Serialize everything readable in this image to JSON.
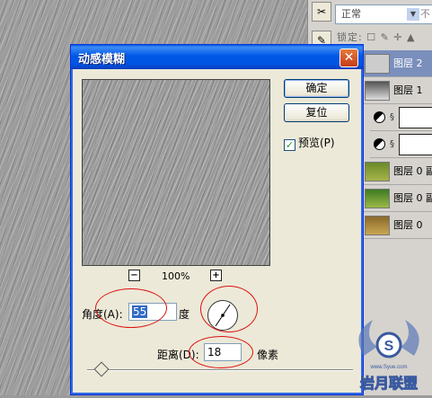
{
  "layers_panel": {
    "blend_mode": "正常",
    "blend_tail": "不",
    "lock_label": "锁定:",
    "lock_icons": "☐ ✎ ✛ ▲",
    "layers": [
      {
        "name": "图层 2",
        "selected": true
      },
      {
        "name": "图层 1",
        "selected": false
      },
      {
        "name": "",
        "adjustment": true
      },
      {
        "name": "",
        "adjustment": true
      },
      {
        "name": "图层 0 副",
        "selected": false
      },
      {
        "name": "图层 0 副",
        "selected": false
      },
      {
        "name": "图层 0",
        "selected": false
      }
    ]
  },
  "dialog": {
    "title": "动感模糊",
    "close_glyph": "✕",
    "ok_label": "确定",
    "reset_label": "复位",
    "preview_label": "预览(P)",
    "preview_checked": true,
    "zoom_out": "−",
    "zoom_in": "+",
    "zoom_value": "100%",
    "angle_label": "角度(A):",
    "angle_value": "55",
    "angle_unit": "度",
    "distance_label": "距离(D):",
    "distance_value": "18",
    "distance_unit": "像素",
    "slider_fraction": 0.06
  },
  "watermark": {
    "text": "岩月联盟",
    "site": "www.Syue.com"
  },
  "colors": {
    "titlebar": "#0054e3",
    "highlight": "#d11",
    "selected_layer": "#7a8fbc"
  }
}
